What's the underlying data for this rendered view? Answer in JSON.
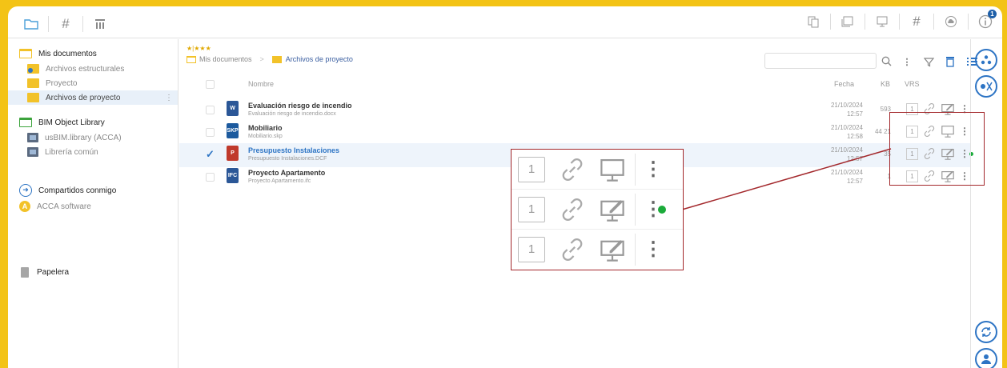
{
  "colors": {
    "accent": "#2d74c4",
    "folder": "#f2c229",
    "highlight": "#a3282c",
    "status_green": "#1bab3a",
    "frame": "#f3c316"
  },
  "toolbar_left": [
    "folder-icon",
    "hash-icon",
    "table-icon"
  ],
  "toolbar_right": [
    "copy-icon",
    "layers-icon",
    "monitor-icon",
    "hash-icon",
    "cloud-icon",
    "info-icon"
  ],
  "info_badge": "1",
  "sidebar": {
    "my_docs": "Mis documentos",
    "folders": [
      "Archivos estructurales",
      "Proyecto",
      "Archivos de proyecto"
    ],
    "bim_library": "BIM Object Library",
    "libraries": [
      "usBIM.library (ACCA)",
      "Librería común"
    ],
    "shared": "Compartidos conmigo",
    "shared_items": [
      "ACCA software"
    ],
    "trash": "Papelera",
    "kebab": "⋮"
  },
  "main": {
    "rating": "★|★★★",
    "breadcrumb": {
      "root": "Mis documentos",
      "sep": ">",
      "current": "Archivos de proyecto"
    },
    "search_placeholder": "",
    "col_name": "Nombre",
    "col_date": "Fecha",
    "col_kb": "KB",
    "col_vrs": "VRS",
    "files": [
      {
        "name": "Evaluación riesgo de incendio",
        "file": "Evaluación riesgo de incendio.docx",
        "date": "21/10/2024",
        "time": "12:57",
        "kb": "593",
        "version": "1",
        "type": "W",
        "type_color": "#2b5797",
        "edit": "pencil",
        "selected": false
      },
      {
        "name": "Mobiliario",
        "file": "Mobiliario.skp",
        "date": "21/10/2024",
        "time": "12:58",
        "kb": "44 21",
        "version": "1",
        "type": "SKP",
        "type_color": "#1c5a9e",
        "edit": "monitor",
        "selected": false
      },
      {
        "name": "Presupuesto Instalaciones",
        "file": "Presupuesto Instalaciones.DCF",
        "date": "21/10/2024",
        "time": "12:57",
        "kb": "35",
        "version": "1",
        "type": "P",
        "type_color": "#c0392b",
        "edit": "pencil",
        "selected": true,
        "status_dot": true
      },
      {
        "name": "Proyecto Apartamento",
        "file": "Proyecto Apartamento.ifc",
        "date": "21/10/2024",
        "time": "12:57",
        "kb": "1",
        "version": "1",
        "type": "IFC",
        "type_color": "#2b5797",
        "edit": "pencil",
        "selected": false
      }
    ]
  },
  "zoom": [
    {
      "version": "1",
      "edit": "monitor",
      "dots": "⋮",
      "status_dot": false
    },
    {
      "version": "1",
      "edit": "pencil",
      "dots": "⋮",
      "status_dot": true
    },
    {
      "version": "1",
      "edit": "pencil",
      "dots": "⋮",
      "status_dot": false
    }
  ],
  "rail": [
    "share-network-icon",
    "tools-icon",
    "sync-icon",
    "users-icon"
  ]
}
